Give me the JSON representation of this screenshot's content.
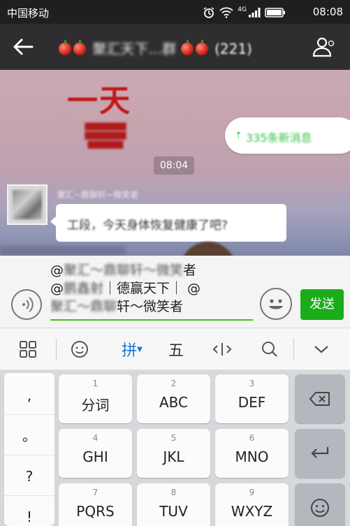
{
  "status_bar": {
    "carrier": "中国移动",
    "network": "4G",
    "time": "08:08"
  },
  "title_bar": {
    "title_prefix": "",
    "title_blurred": "聚汇天下…群",
    "member_count": "(221)"
  },
  "chat": {
    "poster_text": "一天",
    "unread_banner": "335条新消息",
    "timestamp": "08:04",
    "sender_name": "聚汇~鼎聊轩~微笑者",
    "message": "工段，今天身体恢复健康了吧?"
  },
  "input": {
    "line1_prefix": "@",
    "line1_blur": "聚汇～鼎聊轩～微笑",
    "line1_suffix": "者",
    "line2_prefix": "@",
    "line2_blur": "鹏鑫射",
    "line2_suffix": "｜德赢天下｜ @",
    "line3_blur": "聚汇～鼎聊",
    "line3_suffix": "轩～微笑者",
    "send_label": "发送"
  },
  "ime_toolbar": {
    "pinyin_label": "拼",
    "wubi_label": "五"
  },
  "keyboard": {
    "punctuation": [
      ",",
      "。",
      "?",
      "!"
    ],
    "keys": [
      {
        "num": "1",
        "label": "分词"
      },
      {
        "num": "2",
        "label": "ABC"
      },
      {
        "num": "3",
        "label": "DEF"
      },
      {
        "num": "4",
        "label": "GHI"
      },
      {
        "num": "5",
        "label": "JKL"
      },
      {
        "num": "6",
        "label": "MNO"
      },
      {
        "num": "7",
        "label": "PQRS"
      },
      {
        "num": "8",
        "label": "TUV"
      },
      {
        "num": "9",
        "label": "WXYZ"
      }
    ]
  },
  "colors": {
    "accent_green": "#1aad19",
    "ime_blue": "#1a73d8",
    "titlebar": "#2e2e30"
  }
}
